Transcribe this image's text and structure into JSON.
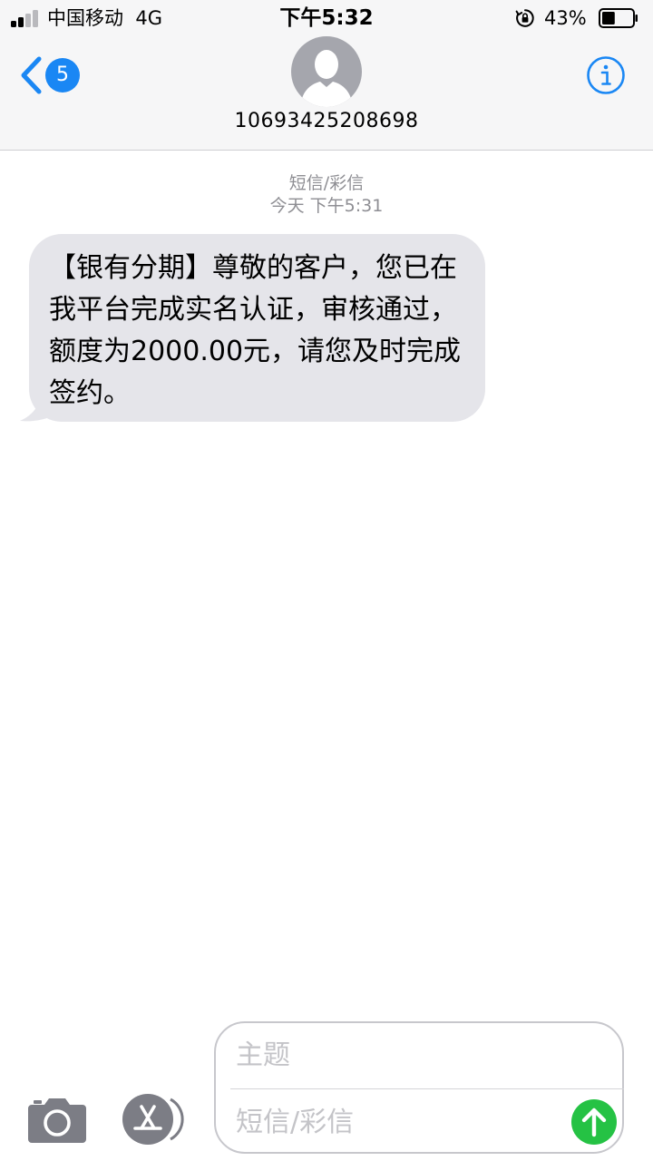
{
  "status_bar": {
    "carrier": "中国移动",
    "network": "4G",
    "time": "下午5:32",
    "battery_percent": "43%",
    "battery_level": 0.43
  },
  "nav": {
    "back_badge": "5",
    "contact_number": "10693425208698"
  },
  "thread": {
    "message_type": "短信/彩信",
    "timestamp": "今天 下午5:31",
    "messages": [
      {
        "direction": "incoming",
        "text": "【银有分期】尊敬的客户，您已在我平台完成实名认证，审核通过，额度为2000.00元，请您及时完成签约。"
      }
    ]
  },
  "compose": {
    "subject_placeholder": "主题",
    "message_placeholder": "短信/彩信"
  },
  "icons": {
    "back": "chevron-left-icon",
    "avatar": "person-silhouette-icon",
    "info": "info-icon",
    "camera": "camera-icon",
    "appstore": "app-store-icon",
    "send": "arrow-up-icon",
    "lock": "orientation-lock-icon",
    "battery": "battery-icon",
    "signal": "signal-bars-icon"
  },
  "colors": {
    "accent": "#1a87f4",
    "bubble_incoming": "#e5e5ea",
    "send_button": "#25c244",
    "icon_gray": "#7c7d85",
    "meta_text": "#8e8e93"
  }
}
